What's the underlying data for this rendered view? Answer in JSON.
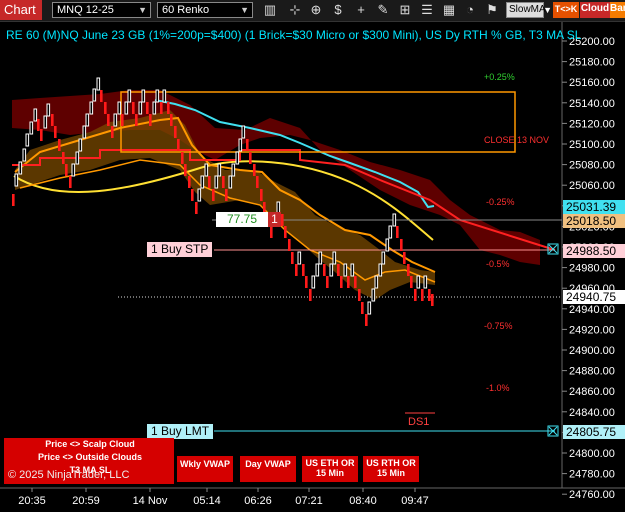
{
  "toolbar": {
    "chart_label": "Chart",
    "instrument": "MNQ 12-25",
    "interval": "60 Renko",
    "ma_select": "SlowMA",
    "tk_button": "T<>K",
    "cloud_button": "Cloud",
    "bar_button": "Bar",
    "icons": [
      "bar-style-icon",
      "crosshair-icon",
      "zoom-in-icon",
      "dollar-zoom-icon",
      "plus-icon",
      "pencil-icon",
      "grid-icon",
      "properties-icon",
      "table-icon",
      "gauge-icon"
    ]
  },
  "title": "RE 60 (M)NQ June 23 GB (1%=200p=$400) (1 Brick=$30 Micro or $300 Mini), US Dy RTH % GB, T3 MA SL",
  "price_axis": {
    "ticks": [
      "25200.00",
      "25180.00",
      "25160.00",
      "25140.00",
      "25120.00",
      "25100.00",
      "25080.00",
      "25060.00",
      "25040.00",
      "25020.00",
      "25000.00",
      "24980.00",
      "24960.00",
      "24940.00",
      "24920.00",
      "24900.00",
      "24880.00",
      "24860.00",
      "24840.00",
      "24820.00",
      "24800.00",
      "24780.00",
      "24760.00"
    ]
  },
  "price_tags": {
    "cyan_ma": "25031.39",
    "level": "25018.50",
    "buy_stp": "24988.50",
    "last": "24940.75",
    "buy_lmt": "24805.75"
  },
  "percent_labels": {
    "p025": "+0.25%",
    "close": "CLOSE 13 NOV",
    "m025": "-0.25%",
    "m05": "-0.5%",
    "m075": "-0.75%",
    "m1": "-1.0%"
  },
  "orders": {
    "stop_label": "1 Buy STP",
    "limit_label": "1 Buy LMT",
    "pnl_value": "77.75",
    "pnl_qty": "1"
  },
  "ds_label": "DS1",
  "time_axis": [
    "20:35",
    "20:59",
    "14 Nov",
    "05:14",
    "06:26",
    "07:21",
    "08:40",
    "09:47"
  ],
  "panel_buttons": {
    "scalp": "Price <> Scalp Cloud",
    "outside": "Price <> Outside Clouds",
    "t3": "T3 MA SL",
    "wkly": "Wkly VWAP",
    "day": "Day VWAP",
    "eth": "US ETH OR 15 Min",
    "rth": "US RTH OR 15 Min"
  },
  "copyright": "© 2025 NinjaTrader, LLC",
  "colors": {
    "bull_brick": "#ffffff",
    "bear_brick": "#ff1a1a",
    "cyan_ma": "#40e0f0",
    "yellow_ma": "#ffe033",
    "orange_band": "#ff9800",
    "cloud": "#8b0000",
    "accent_red": "#d50000"
  }
}
